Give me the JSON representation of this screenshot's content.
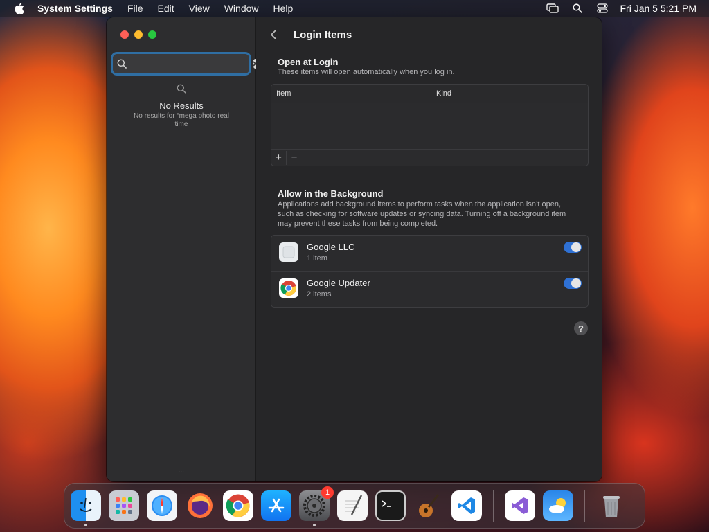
{
  "menubar": {
    "app_name": "System Settings",
    "menus": [
      "File",
      "Edit",
      "View",
      "Window",
      "Help"
    ],
    "clock": "Fri Jan 5  5:21 PM"
  },
  "sidebar": {
    "search": {
      "value": "",
      "placeholder": ""
    },
    "no_results_title": "No Results",
    "no_results_text": "No results for “mega photo real time",
    "more": "..."
  },
  "main": {
    "title": "Login Items",
    "open_at_login": {
      "title": "Open at Login",
      "subtitle": "These items will open automatically when you log in.",
      "columns": [
        "Item",
        "Kind"
      ],
      "add_label": "+",
      "remove_label": "−"
    },
    "background": {
      "title": "Allow in the Background",
      "subtitle": "Applications add background items to perform tasks when the application isn’t open, such as checking for software updates or syncing data. Turning off a background item may prevent these tasks from being completed.",
      "items": [
        {
          "name": "Google LLC",
          "count": "1 item",
          "enabled": true,
          "icon": "generic-app-icon"
        },
        {
          "name": "Google Updater",
          "count": "2 items",
          "enabled": true,
          "icon": "chrome-icon"
        }
      ]
    },
    "help_label": "?"
  },
  "dock": {
    "items": [
      "Finder",
      "Launchpad",
      "Safari",
      "Firefox",
      "Google Chrome",
      "App Store",
      "System Settings",
      "TextEdit",
      "Terminal",
      "GarageBand",
      "Visual Studio Code",
      "Visual Studio",
      "Weather",
      "Trash"
    ],
    "settings_badge": "1"
  },
  "colors": {
    "accent": "#2f71d4",
    "focus_ring": "#2f6ea3"
  }
}
